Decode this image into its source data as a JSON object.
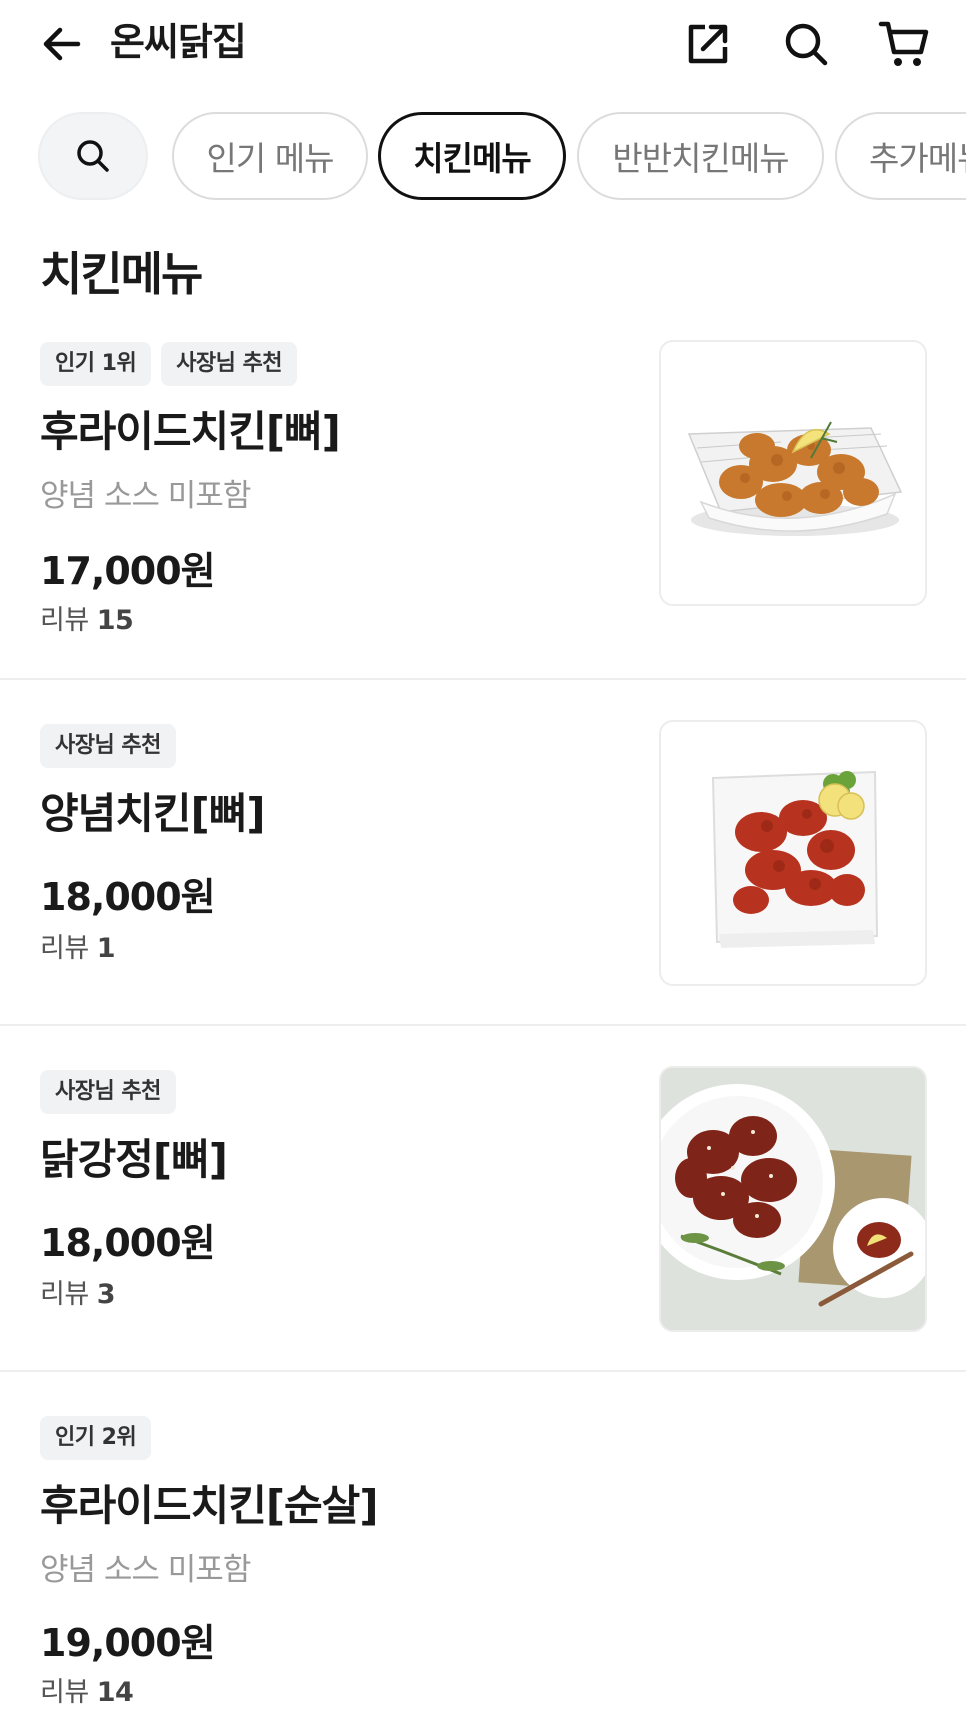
{
  "header": {
    "store_name": "온씨닭집",
    "icons": [
      "back-arrow-icon",
      "share-icon",
      "search-icon",
      "cart-icon"
    ]
  },
  "chips": [
    {
      "label": "인기 메뉴",
      "selected": false
    },
    {
      "label": "치킨메뉴",
      "selected": true
    },
    {
      "label": "반반치킨메뉴",
      "selected": false
    },
    {
      "label": "추가메뉴",
      "selected": false
    }
  ],
  "section_title": "치킨메뉴",
  "items": [
    {
      "badges": [
        "인기 1위",
        "사장님 추천"
      ],
      "name": "후라이드치킨[뼈]",
      "desc": "양념 소스 미포함",
      "price": "17,000원",
      "review_label": "리뷰",
      "review_count": "15"
    },
    {
      "badges": [
        "사장님 추천"
      ],
      "name": "양념치킨[뼈]",
      "price": "18,000원",
      "review_label": "리뷰",
      "review_count": "1"
    },
    {
      "badges": [
        "사장님 추천"
      ],
      "name": "닭강정[뼈]",
      "price": "18,000원",
      "review_label": "리뷰",
      "review_count": "3"
    },
    {
      "badges": [
        "인기 2위"
      ],
      "name": "후라이드치킨[순살]",
      "desc": "양념 소스 미포함",
      "price": "19,000원",
      "review_label": "리뷰",
      "review_count": "14"
    }
  ],
  "colors": {
    "text": "#1a1a1a",
    "muted": "#999999",
    "badge_bg": "#f1f2f4",
    "chip_border": "#dcdcdc",
    "selected_chip_border": "#111111"
  }
}
